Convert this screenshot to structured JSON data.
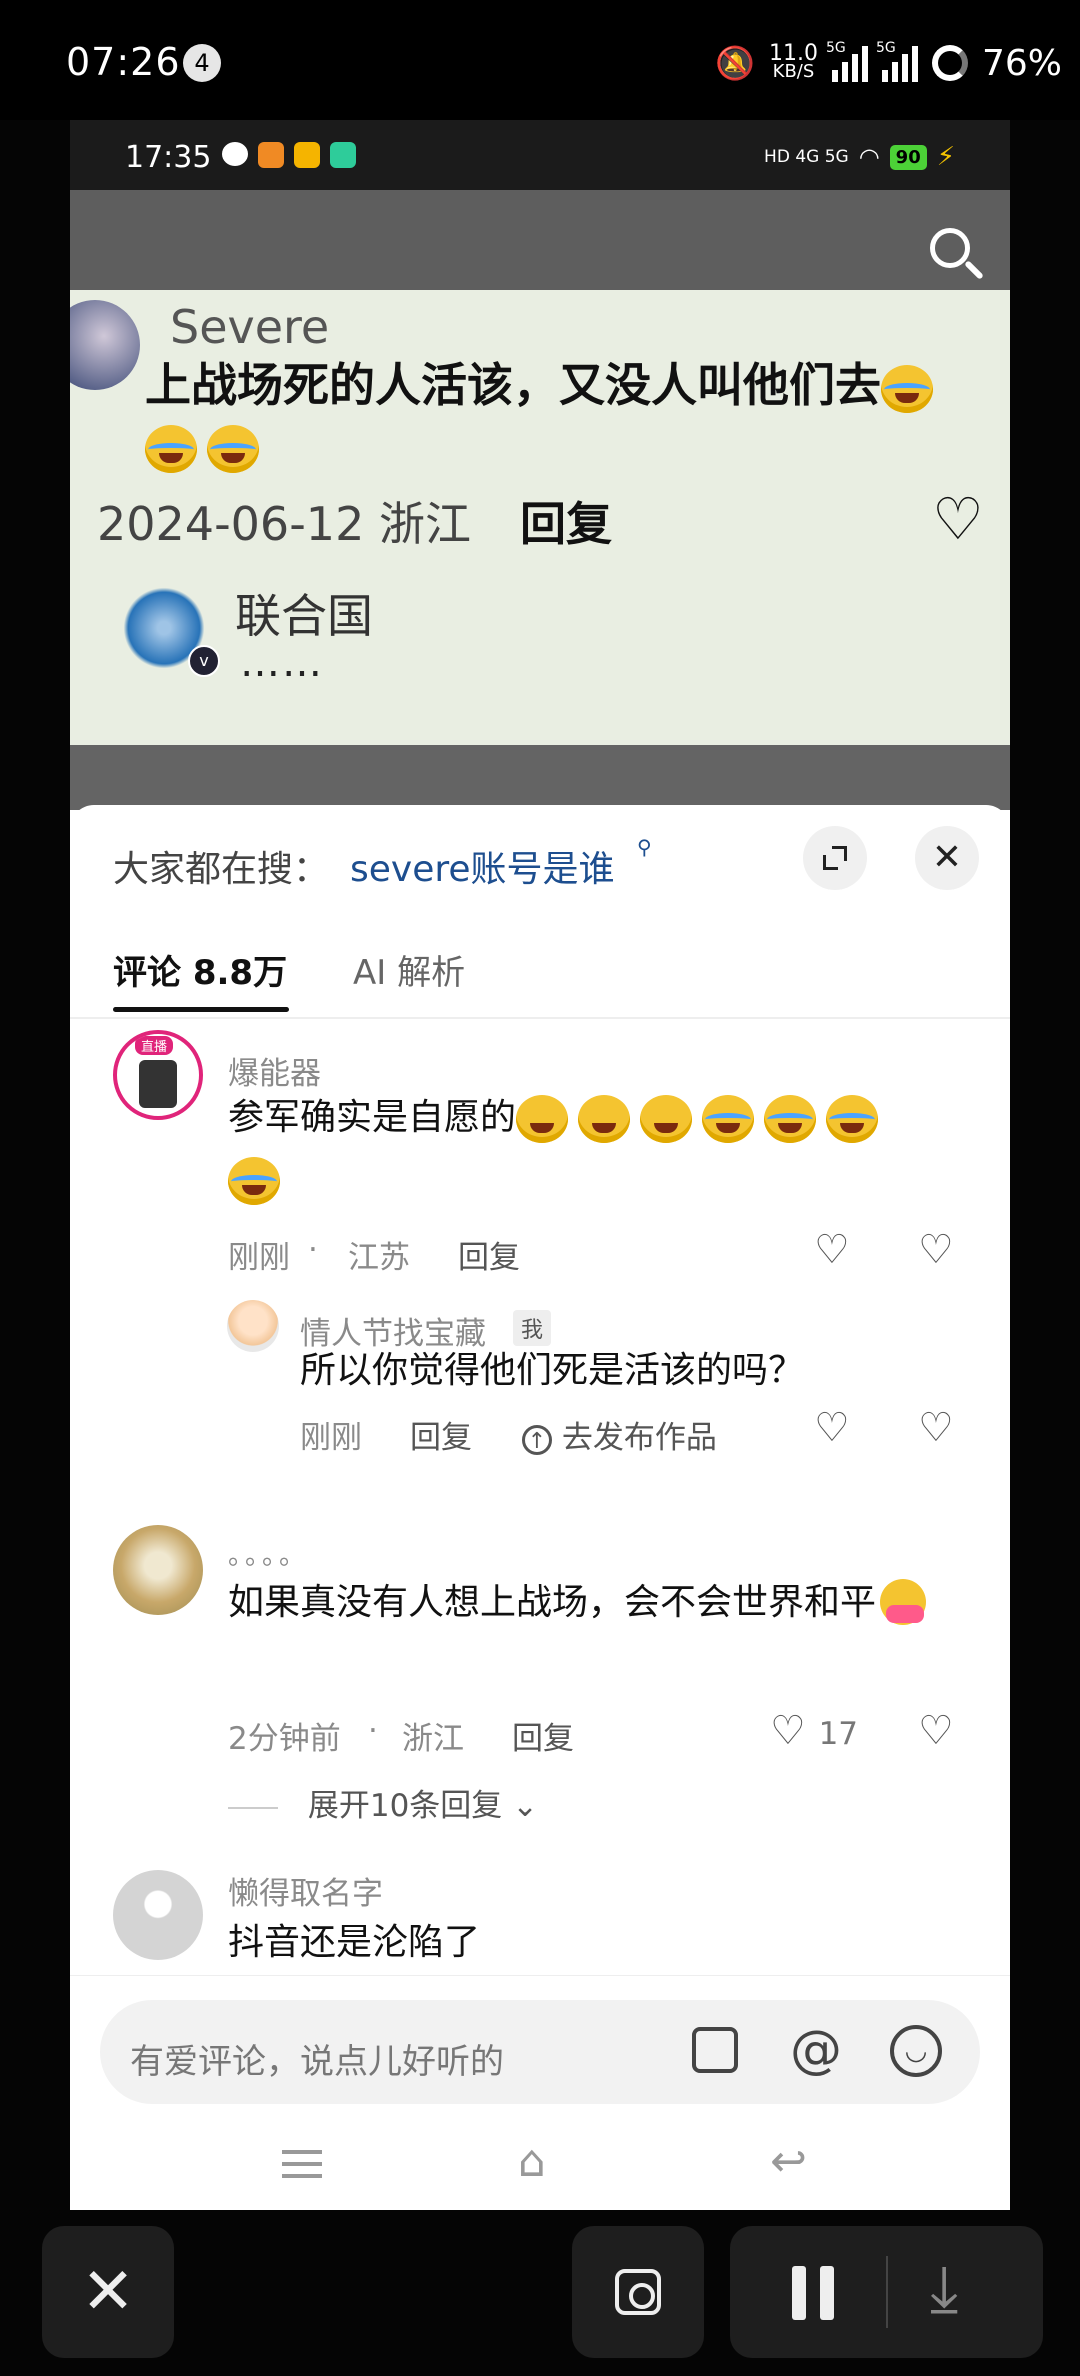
{
  "outer_status": {
    "time": "07:26",
    "notification_count": "4",
    "net_speed_value": "11.0",
    "net_speed_unit": "KB/S",
    "signal1_label": "5G",
    "signal2_label": "5G",
    "battery": "76%"
  },
  "inner_status": {
    "time": "17:35",
    "indicators": "HD 4G 5G",
    "battery": "90"
  },
  "screenshot_card": {
    "username": "Severe",
    "comment": "上战场死的人活该，又没人叫他们去",
    "date_location": "2024-06-12 浙江",
    "reply": "回复",
    "reply_user": "联合国",
    "reply_text": "……"
  },
  "panel": {
    "trending_label": "大家都在搜：",
    "trending_query": "severe账号是谁",
    "tabs": [
      {
        "label": "评论 8.8万",
        "active": true
      },
      {
        "label": "AI 解析",
        "active": false
      }
    ],
    "comments": [
      {
        "name": "爆能器",
        "avatar_badge": "直播",
        "text": "参军确实是自愿的",
        "time": "刚刚",
        "location": "江苏",
        "reply": "回复"
      },
      {
        "name": "情人节找宝藏",
        "me_badge": "我",
        "text": "所以你觉得他们死是活该的吗？",
        "time": "刚刚",
        "reply": "回复",
        "publish": "去发布作品"
      },
      {
        "name": "。。。。",
        "text": "如果真没有人想上战场，会不会世界和平",
        "time": "2分钟前",
        "location": "浙江",
        "reply": "回复",
        "likes": "17",
        "expand": "展开10条回复"
      },
      {
        "name": "懒得取名字",
        "text": "抖音还是沦陷了"
      }
    ],
    "input_placeholder": "有爱评论，说点儿好听的"
  },
  "colors": {
    "accent_link": "#1d4e8f",
    "battery_green": "#4cd137"
  },
  "icons": [
    "search-icon",
    "expand-icon",
    "close-icon",
    "heart-icon",
    "dislike-icon",
    "image-icon",
    "at-icon",
    "emoji-icon",
    "pause-icon",
    "download-icon",
    "scan-icon"
  ]
}
